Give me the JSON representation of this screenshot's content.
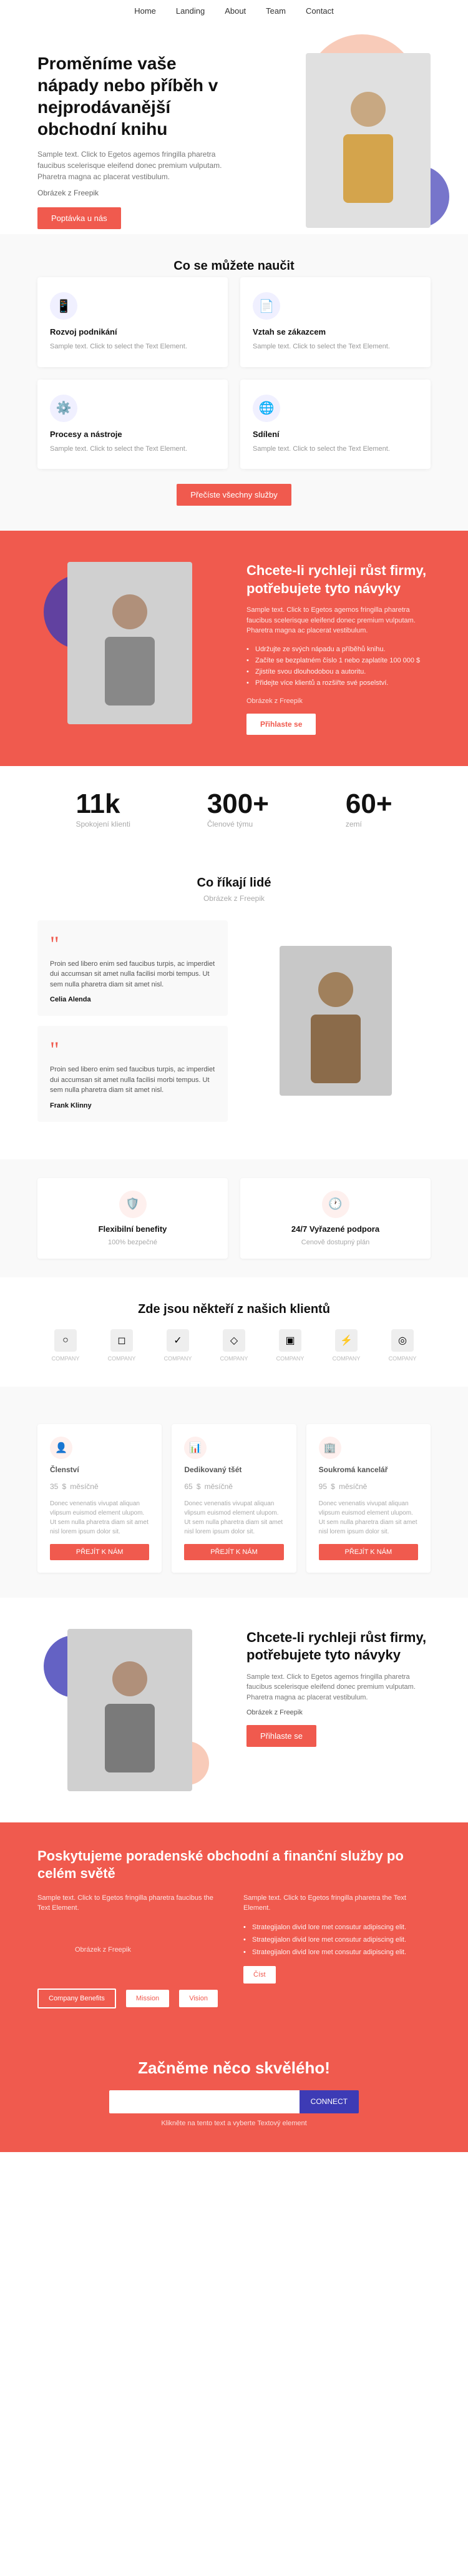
{
  "nav": {
    "links": [
      "Home",
      "Landing",
      "About",
      "Team",
      "Contact"
    ]
  },
  "hero": {
    "title": "Proměníme vaše nápady nebo příběh v nejprodávanější obchodní knihu",
    "body": "Sample text. Click to Egetos agemos fringilla pharetra faucibus scelerisque eleifend donec premium vulputam. Pharetra magna ac placerat vestibulum.",
    "link": "Obrázek z Freepik",
    "cta_button": "Poptávka u nás"
  },
  "learn": {
    "section_title": "Co se můžete naučit",
    "cards": [
      {
        "icon": "📱",
        "title": "Rozvoj podnikání",
        "body": "Sample text. Click to select the Text Element."
      },
      {
        "icon": "📄",
        "title": "Vztah se zákazcem",
        "body": "Sample text. Click to select the Text Element."
      },
      {
        "icon": "⚙️",
        "title": "Procesy a nástroje",
        "body": "Sample text. Click to select the Text Element."
      },
      {
        "icon": "🌐",
        "title": "Sdílení",
        "body": "Sample text. Click to select the Text Element."
      }
    ],
    "cta_button": "Přečíste všechny služby"
  },
  "grow": {
    "title": "Chcete-li rychleji růst firmy, potřebujete tyto návyky",
    "body": "Sample text. Click to Egetos agemos fringilla pharetra faucibus scelerisque eleifend donec premium vulputam. Pharetra magna ac placerat vestibulum.",
    "bullets": [
      "Udržujte ze svých nápadu a příběhů knihu.",
      "Začíte se bezplatném číslo 1 nebo zaplatíte 100 000 $",
      "Zjistíte svou dlouhodobou a autoritu.",
      "Přidejte více klientů a rozšiřte své poselství."
    ],
    "link": "Obrázek z Freepik",
    "cta_button": "Přihlaste se"
  },
  "stats": [
    {
      "number": "11k",
      "label": "Spokojení klienti"
    },
    {
      "number": "300+",
      "label": "Členové týmu"
    },
    {
      "number": "60+",
      "label": "zemí"
    }
  ],
  "testimonials": {
    "section_title": "Co říkají lidé",
    "section_sub": "Obrázek z Freepik",
    "items": [
      {
        "quote": "Proin sed libero enim sed faucibus turpis, ac imperdiet dui accumsan sit amet nulla facilisi morbi tempus. Ut sem nulla pharetra diam sit amet nisl.",
        "author": "Celia Alenda"
      },
      {
        "quote": "Proin sed libero enim sed faucibus turpis, ac imperdiet dui accumsan sit amet nulla facilisi morbi tempus. Ut sem nulla pharetra diam sit amet nisl.",
        "author": "Frank Klinny"
      }
    ]
  },
  "benefits": [
    {
      "icon": "🛡️",
      "title": "Flexibilní benefity",
      "sub": "100% bezpečné",
      "body": ""
    },
    {
      "icon": "🕐",
      "title": "24/7 Vyřazené podpora",
      "sub": "Cenově dostupný plán",
      "body": ""
    }
  ],
  "clients": {
    "section_title": "Zde jsou někteří z našich klientů",
    "logos": [
      {
        "icon": "○",
        "label": "COMPANY"
      },
      {
        "icon": "◻",
        "label": "COMPANY"
      },
      {
        "icon": "✓",
        "label": "COMPANY"
      },
      {
        "icon": "◇",
        "label": "COMPANY"
      },
      {
        "icon": "▣",
        "label": "COMPANY"
      },
      {
        "icon": "⚡",
        "label": "COMPANY"
      },
      {
        "icon": "◎",
        "label": "COMPANY"
      }
    ]
  },
  "pricing": {
    "plans": [
      {
        "icon": "👤",
        "name": "Členství",
        "price": "35",
        "currency": "$",
        "period": "měsíčně",
        "body": "Donec venenatis vivupat aliquan vlipsum euismod element ulupom. Ut sem nulla pharetra diam sit amet nisl lorem ipsum dolor sit.",
        "cta": "PŘEJÍT K NÁM",
        "badge": ""
      },
      {
        "icon": "📊",
        "name": "Dedikovaný tšét",
        "price": "65",
        "currency": "$",
        "period": "měsíčně",
        "body": "Donec venenatis vivupat aliquan vlipsum euismod element ulupom. Ut sem nulla pharetra diam sit amet nisl lorem ipsum dolor sit.",
        "cta": "PŘEJÍT K NÁM",
        "badge": ""
      },
      {
        "icon": "🏢",
        "name": "Soukromá kancelář",
        "price": "95",
        "currency": "$",
        "period": "měsíčně",
        "body": "Donec venenatis vivupat aliquan vlipsum euismod element ulupom. Ut sem nulla pharetra diam sit amet nisl lorem ipsum dolor sit.",
        "cta": "PŘEJÍT K NÁM",
        "badge": ""
      }
    ]
  },
  "grow2": {
    "title": "Chcete-li rychleji růst firmy, potřebujete tyto návyky",
    "body": "Sample text. Click to Egetos agemos fringilla pharetra faucibus scelerisque eleifend donec premium vulputam. Pharetra magna ac placerat vestibulum.",
    "link": "Obrázek z Freepik",
    "cta_button": "Přihlaste se"
  },
  "services": {
    "title": "Poskytujeme poradenské obchodní a finanční služby po celém světě",
    "left_body": "Sample text. Click to Egetos fringilla pharetra faucibus the Text Element.",
    "left_link": "Obrázek z Freepik",
    "btn1": "Company Benefits",
    "btn2": "Mission",
    "btn3": "Vision",
    "right_body": "Sample text. Click to Egetos fringilla pharetra the Text Element.",
    "list": [
      "Strategijalon divid lore met consutur adipiscing elit.",
      "Strategijalon divid lore met consutur adipiscing elit.",
      "Strategijalon divid lore met consutur adipiscing elit."
    ],
    "sub_btn": "Číst"
  },
  "cta": {
    "title": "Začněme něco skvělého!",
    "input_placeholder": "",
    "button_label": "CONNECT",
    "note": "Klikněte na tento text a vyberte Textový element"
  }
}
